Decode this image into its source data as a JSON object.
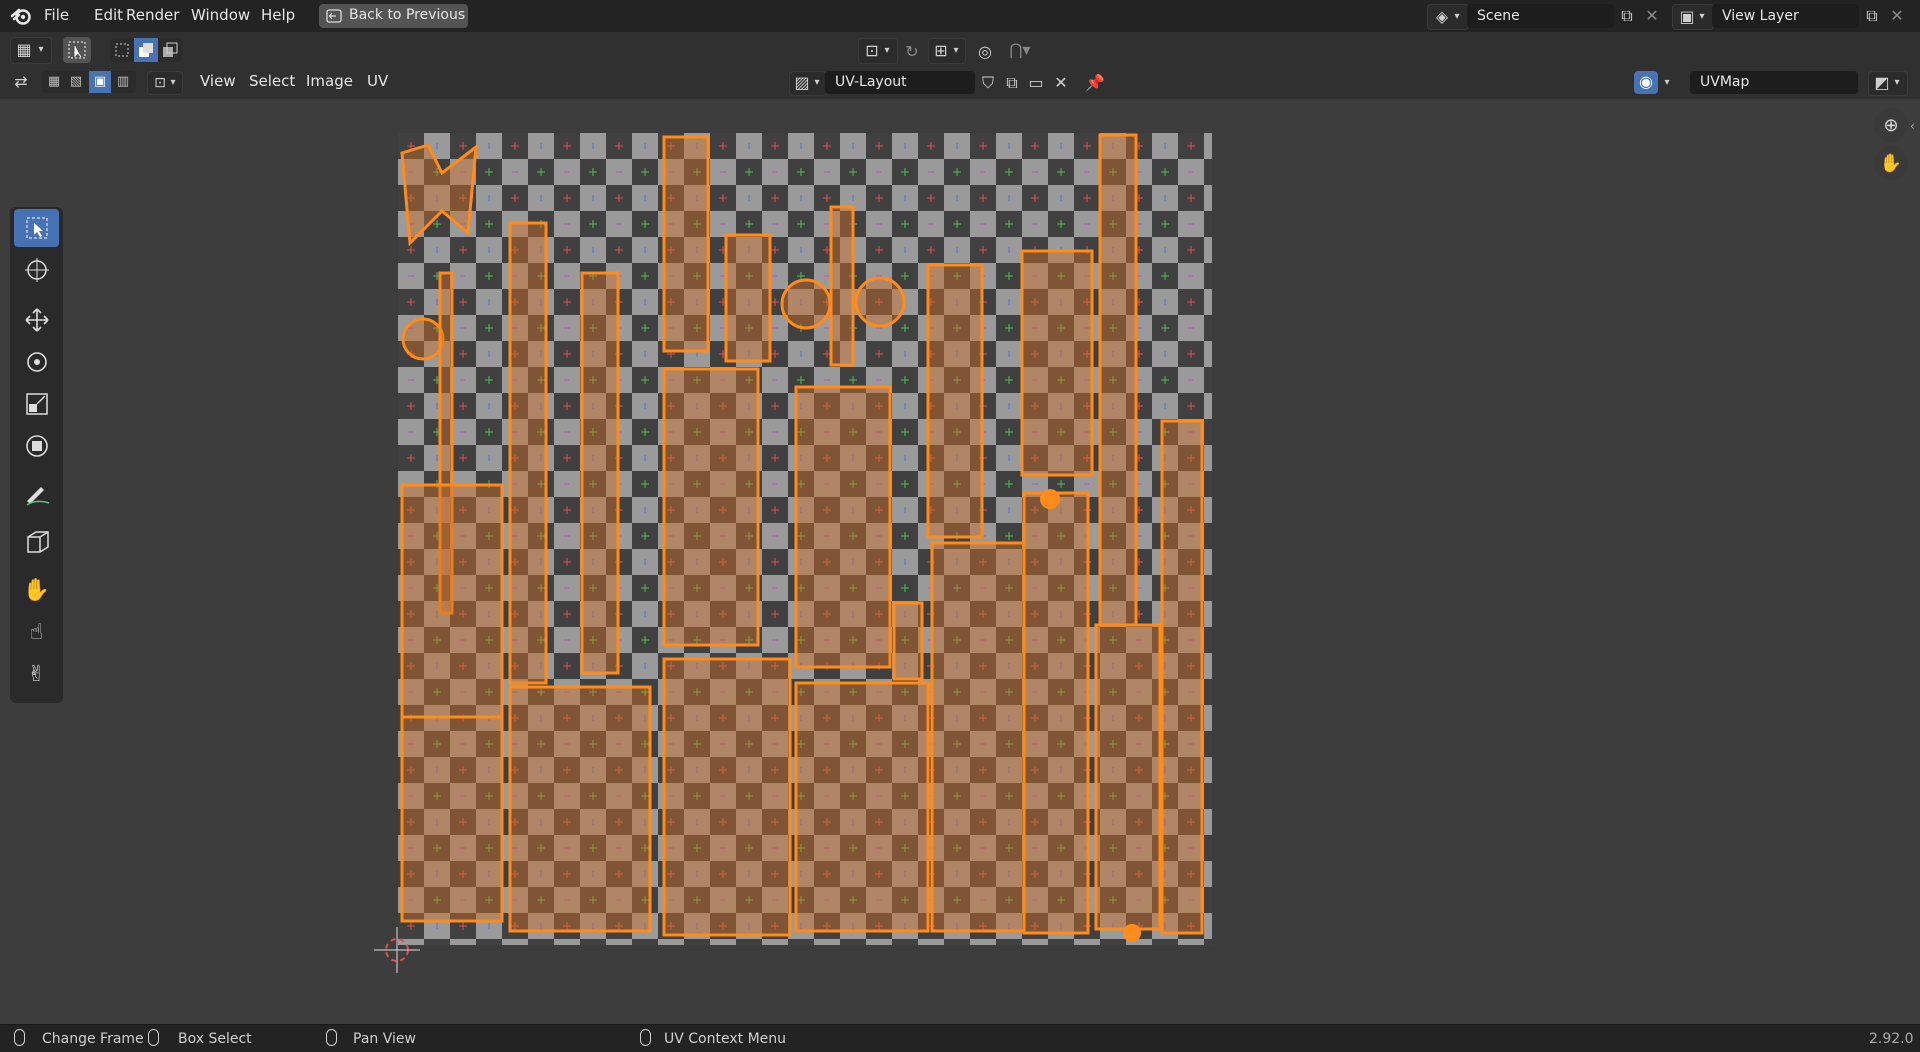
{
  "topbar": {
    "menus": [
      "File",
      "Edit",
      "Render",
      "Window",
      "Help"
    ],
    "back_button": "Back to Previous",
    "scene_label": "Scene",
    "view_layer_label": "View Layer"
  },
  "header": {
    "menus": [
      "View",
      "Select",
      "Image",
      "UV"
    ],
    "image_name": "UV-Layout",
    "uvmap_name": "UVMap"
  },
  "tools": [
    {
      "name": "select-box-tool",
      "icon": "select-box-icon",
      "active": true
    },
    {
      "name": "cursor-tool",
      "icon": "cursor-icon",
      "active": false
    },
    {
      "name": "move-tool",
      "icon": "move-icon",
      "active": false
    },
    {
      "name": "rotate-tool",
      "icon": "rotate-icon",
      "active": false
    },
    {
      "name": "scale-tool",
      "icon": "scale-icon",
      "active": false
    },
    {
      "name": "transform-tool",
      "icon": "transform-icon",
      "active": false
    },
    {
      "name": "annotate-tool",
      "icon": "annotate-icon",
      "active": false
    },
    {
      "name": "rip-region-tool",
      "icon": "rip-icon",
      "active": false
    },
    {
      "name": "grab-tool",
      "icon": "grab-hand-icon",
      "active": false
    },
    {
      "name": "relax-tool",
      "icon": "relax-icon",
      "active": false
    },
    {
      "name": "pinch-tool",
      "icon": "pinch-icon",
      "active": false
    }
  ],
  "statusbar": {
    "items": [
      "Change Frame",
      "Box Select",
      "Pan View",
      "UV Context Menu"
    ],
    "version": "2.92.0"
  },
  "colors": {
    "accent": "#4772b3",
    "uv_edge": "#ff8c1a",
    "checker_dark": "#3a3a3a",
    "checker_light": "#9a9a9a"
  }
}
